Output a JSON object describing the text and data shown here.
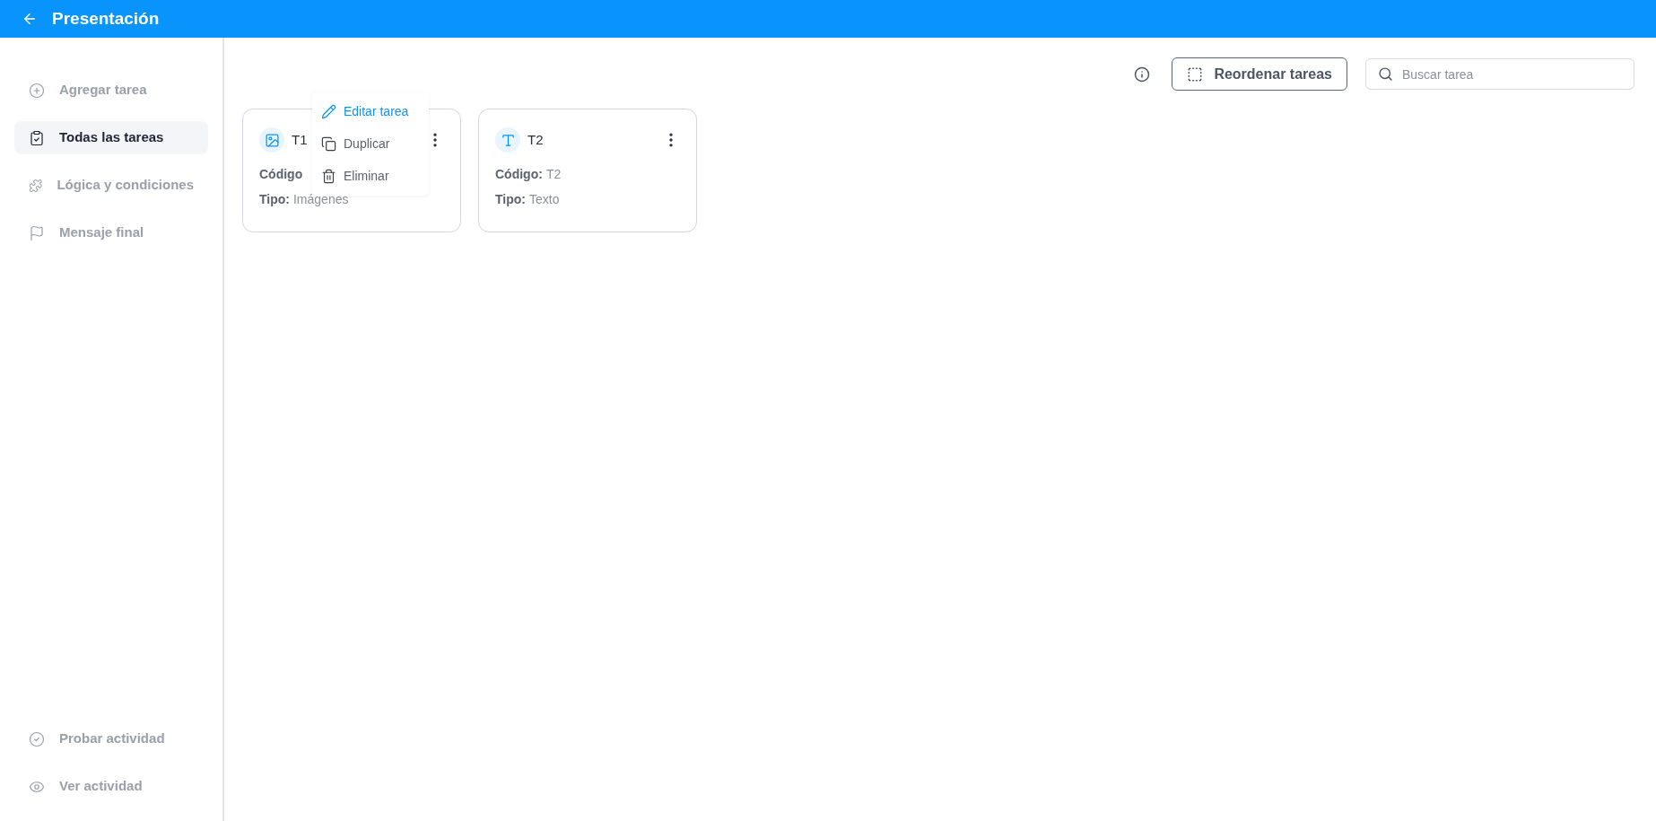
{
  "header": {
    "title": "Presentación"
  },
  "sidebar": {
    "items": [
      {
        "label": "Agregar tarea",
        "selected": false
      },
      {
        "label": "Todas las tareas",
        "selected": true
      },
      {
        "label": "Lógica y condiciones",
        "selected": false
      },
      {
        "label": "Mensaje final",
        "selected": false
      }
    ],
    "bottom_items": [
      {
        "label": "Probar actividad"
      },
      {
        "label": "Ver actividad"
      }
    ]
  },
  "toolbar": {
    "reorder_button": "Reordenar tareas",
    "search": {
      "placeholder": "Buscar tarea"
    }
  },
  "cards": [
    {
      "title": "T1",
      "kind": "image",
      "fields": [
        {
          "label": "Código"
        },
        {
          "label": "Tipo:",
          "value": "Imágenes"
        }
      ],
      "menu": [
        {
          "label": "Editar tarea",
          "selected": true
        },
        {
          "label": "Duplicar",
          "selected": false
        },
        {
          "label": "Eliminar",
          "selected": false
        }
      ]
    },
    {
      "title": "T2",
      "kind": "text",
      "fields": [
        {
          "label": "Código:",
          "value": "T2"
        },
        {
          "label": "Tipo:",
          "value": "Texto"
        }
      ]
    }
  ]
}
